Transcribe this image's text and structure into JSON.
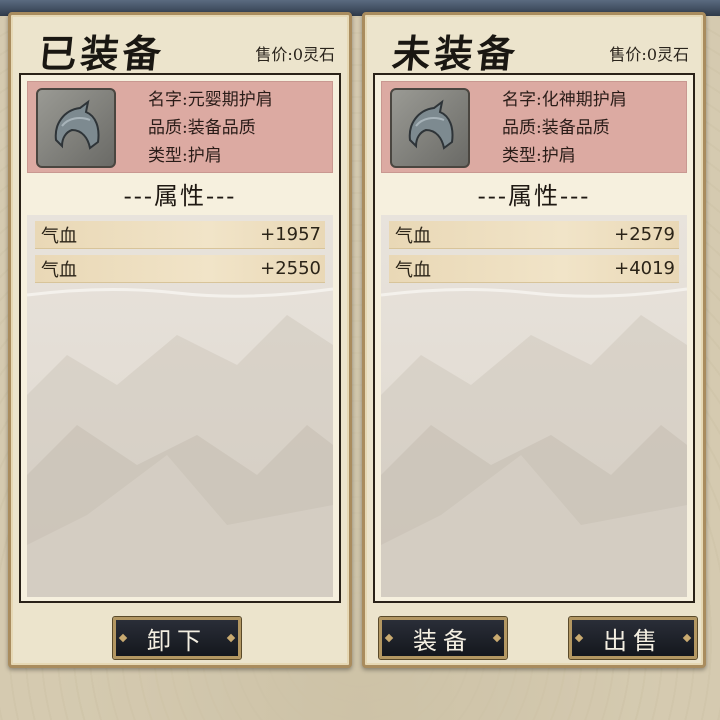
{
  "equipped": {
    "title": "已装备",
    "sell_price": "售价:0灵石",
    "item": {
      "name_label": "名字:",
      "name": "元婴期护肩",
      "quality_label": "品质:",
      "quality": "装备品质",
      "type_label": "类型:",
      "type": "护肩",
      "icon": "shoulder-armor-icon"
    },
    "attr_header": "---属性---",
    "attributes": [
      {
        "name": "气血",
        "value": "+1957"
      },
      {
        "name": "气血",
        "value": "+2550"
      }
    ],
    "buttons": {
      "unequip": "卸下"
    }
  },
  "unequipped": {
    "title": "未装备",
    "sell_price": "售价:0灵石",
    "item": {
      "name_label": "名字:",
      "name": "化神期护肩",
      "quality_label": "品质:",
      "quality": "装备品质",
      "type_label": "类型:",
      "type": "护肩",
      "icon": "shoulder-armor-icon"
    },
    "attr_header": "---属性---",
    "attributes": [
      {
        "name": "气血",
        "value": "+2579"
      },
      {
        "name": "气血",
        "value": "+4019"
      }
    ],
    "buttons": {
      "equip": "装备",
      "sell": "出售"
    }
  },
  "colors": {
    "panel_border": "#a98c5e",
    "item_card": "#dcaaa2",
    "button_bg": "#14171d",
    "button_border": "#b39762"
  }
}
